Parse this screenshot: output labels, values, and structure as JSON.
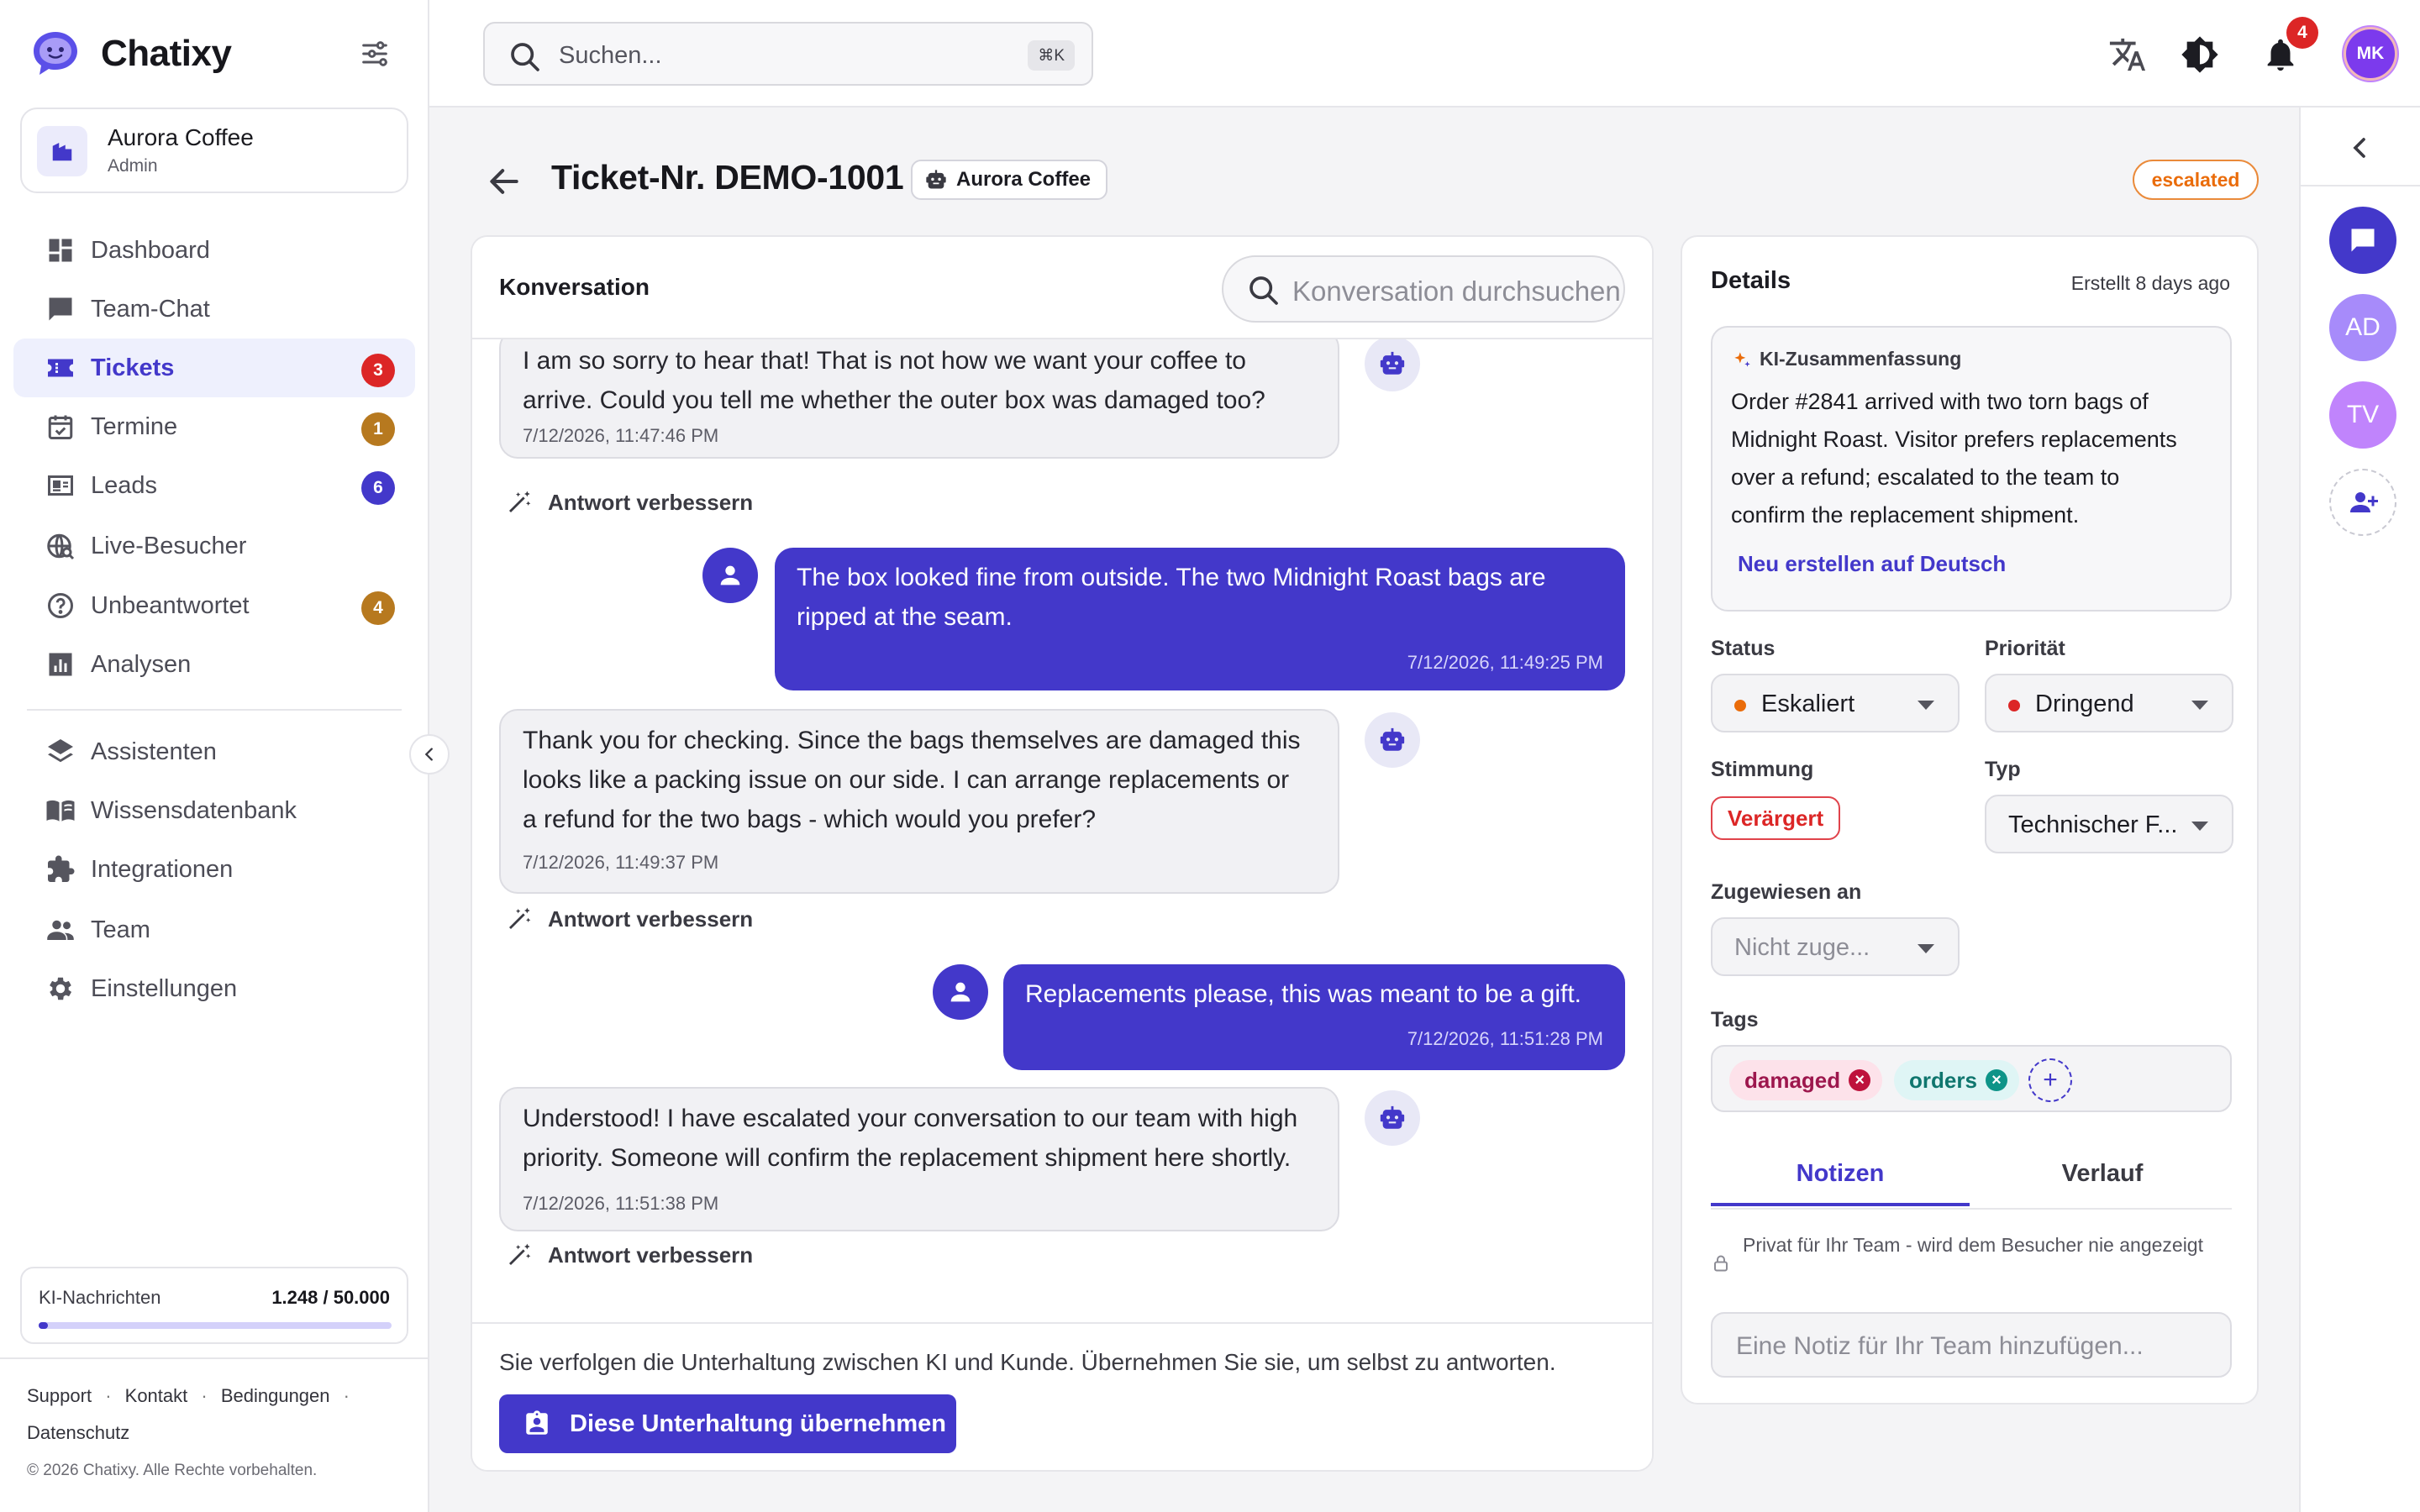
{
  "app": {
    "name": "Chatixy"
  },
  "workspace": {
    "name": "Aurora Coffee",
    "role": "Admin"
  },
  "nav": {
    "primary": [
      {
        "label": "Dashboard",
        "icon": "dashboard-icon"
      },
      {
        "label": "Team-Chat",
        "icon": "chat-icon"
      },
      {
        "label": "Tickets",
        "icon": "ticket-icon",
        "badge": "3",
        "badge_color": "#dc2626",
        "active": true
      },
      {
        "label": "Termine",
        "icon": "calendar-icon",
        "badge": "1",
        "badge_color": "#b7791f"
      },
      {
        "label": "Leads",
        "icon": "contact-card-icon",
        "badge": "6",
        "badge_color": "#4338ca"
      },
      {
        "label": "Live-Besucher",
        "icon": "live-visitors-icon"
      },
      {
        "label": "Unbeantwortet",
        "icon": "question-icon",
        "badge": "4",
        "badge_color": "#b7791f"
      },
      {
        "label": "Analysen",
        "icon": "analytics-icon"
      }
    ],
    "secondary": [
      {
        "label": "Assistenten",
        "icon": "layers-icon"
      },
      {
        "label": "Wissensdatenbank",
        "icon": "book-icon"
      },
      {
        "label": "Integrationen",
        "icon": "puzzle-icon"
      },
      {
        "label": "Team",
        "icon": "people-icon"
      },
      {
        "label": "Einstellungen",
        "icon": "gear-icon"
      }
    ]
  },
  "quota": {
    "label": "KI-Nachrichten",
    "value": "1.248 / 50.000",
    "used_fraction": 0.025
  },
  "footer": {
    "links": [
      "Support",
      "Kontakt",
      "Bedingungen",
      "Datenschutz"
    ],
    "separator": "·",
    "copyright": "© 2026 Chatixy. Alle Rechte vorbehalten."
  },
  "topbar": {
    "search_placeholder": "Suchen...",
    "shortcut": "⌘K",
    "notification_count": "4",
    "user_initials": "MK"
  },
  "ticket": {
    "title": "Ticket-Nr. DEMO-1001",
    "org": "Aurora Coffee",
    "status": "escalated"
  },
  "conversation": {
    "title": "Konversation",
    "search_placeholder": "Konversation durchsuchen",
    "improve_label": "Antwort verbessern",
    "messages": [
      {
        "role": "bot",
        "lines": [
          "I am so sorry to hear that! That is not how we want your coffee to",
          "arrive. Could you tell me whether the outer box was damaged too?"
        ],
        "time": "7/12/2026, 11:47:46 PM"
      },
      {
        "role": "user",
        "lines": [
          "The box looked fine from outside. The two Midnight Roast bags are",
          "ripped at the seam."
        ],
        "time": "7/12/2026, 11:49:25 PM"
      },
      {
        "role": "bot",
        "lines": [
          "Thank you for checking. Since the bags themselves are damaged this",
          "looks like a packing issue on our side. I can arrange replacements or",
          "a refund for the two bags - which would you prefer?"
        ],
        "time": "7/12/2026, 11:49:37 PM"
      },
      {
        "role": "user",
        "lines": [
          "Replacements please, this was meant to be a gift."
        ],
        "time": "7/12/2026, 11:51:28 PM"
      },
      {
        "role": "bot",
        "lines": [
          "Understood! I have escalated your conversation to our team with high",
          "priority. Someone will confirm the replacement shipment here shortly."
        ],
        "time": "7/12/2026, 11:51:38 PM"
      }
    ],
    "footer_note": "Sie verfolgen die Unterhaltung zwischen KI und Kunde. Übernehmen Sie sie, um selbst zu antworten.",
    "takeover_label": "Diese Unterhaltung übernehmen"
  },
  "details": {
    "title": "Details",
    "created": "Erstellt 8 days ago",
    "ai_summary": {
      "label": "KI-Zusammenfassung",
      "lines": [
        "Order #2841 arrived with two torn bags of",
        "Midnight Roast. Visitor prefers replacements",
        "over a refund; escalated to the team to",
        "confirm the replacement shipment."
      ],
      "regenerate": "Neu erstellen auf Deutsch"
    },
    "status_label": "Status",
    "status_value": "Eskaliert",
    "status_color": "#ea6c0a",
    "priority_label": "Priorität",
    "priority_value": "Dringend",
    "priority_color": "#dc2626",
    "mood_label": "Stimmung",
    "mood_value": "Verärgert",
    "type_label": "Typ",
    "type_value": "Technischer F...",
    "assignee_label": "Zugewiesen an",
    "assignee_placeholder": "Nicht zuge...",
    "tags_label": "Tags",
    "tags": [
      {
        "label": "damaged",
        "bg": "#fde2ea",
        "color": "#9d174d",
        "x_color": "#be123c"
      },
      {
        "label": "orders",
        "bg": "#dff5f5",
        "color": "#0f766e",
        "x_color": "#0e9488"
      }
    ],
    "tabs": [
      "Notizen",
      "Verlauf"
    ],
    "private_note": "Privat für Ihr Team - wird dem Besucher nie angezeigt",
    "note_placeholder": "Eine Notiz für Ihr Team hinzufügen..."
  },
  "rail": {
    "agents": [
      {
        "initials": "AD",
        "color": "#a78bfa"
      },
      {
        "initials": "TV",
        "color": "#c084fc"
      }
    ]
  },
  "colors": {
    "accent": "#4338ca",
    "escalated": "#ea6c0a"
  }
}
